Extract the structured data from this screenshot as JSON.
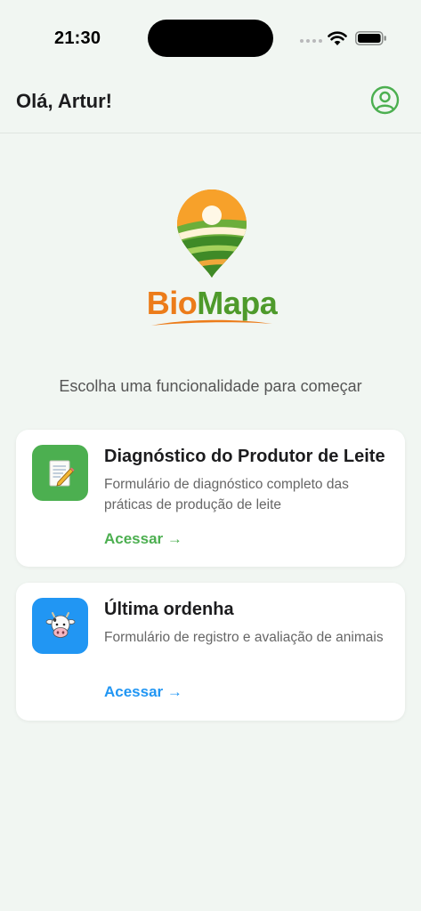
{
  "status_bar": {
    "time": "21:30"
  },
  "header": {
    "greeting": "Olá, Artur!",
    "profile_icon": "user-circle-icon"
  },
  "logo": {
    "text_part_1": "Bio",
    "text_part_2": "Mapa",
    "colors": {
      "orange": "#ec7c1a",
      "green": "#4e9a2b"
    }
  },
  "subtitle": "Escolha uma funcionalidade para começar",
  "cards": [
    {
      "icon": "memo-pencil-icon",
      "title": "Diagnóstico do Produtor de Leite",
      "description": "Formulário de diagnóstico completo das práticas de produção de leite",
      "link_label": "Acessar →",
      "accent": "#4caf50"
    },
    {
      "icon": "cow-face-icon",
      "title": "Última ordenha",
      "description": "Formulário de registro e avaliação de animais",
      "link_label": "Acessar →",
      "accent": "#2196f3"
    }
  ]
}
